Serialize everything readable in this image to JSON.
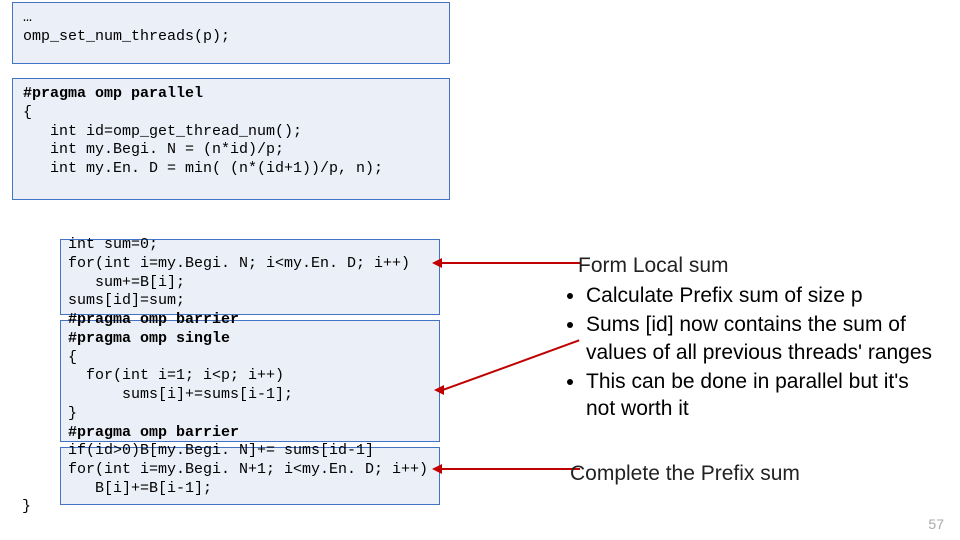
{
  "code": {
    "b1l1": "…",
    "b1l2": "omp_set_num_threads(p);",
    "b2l1a": "#pragma omp parallel",
    "b2l2": "{",
    "b2l3": "   int id=omp_get_thread_num();",
    "b2l4": "   int my.Begi. N = (n*id)/p;",
    "b2l5": "   int my.En. D = min( (n*(id+1))/p, n);",
    "b3l1": "int sum=0;",
    "b3l2": "for(int i=my.Begi. N; i<my.En. D; i++)",
    "b3l3": "   sum+=B[i];",
    "b3l4": "sums[id]=sum;",
    "b3l5a": "#pragma omp barrier",
    "b3l6a": "#pragma omp single",
    "b3l7": "{",
    "b3l8": "  for(int i=1; i<p; i++)",
    "b3l9": "      sums[i]+=sums[i-1];",
    "b3l10": "}",
    "b3l11a": "#pragma omp barrier",
    "b3l12": "if(id>0)B[my.Begi. N]+= sums[id-1]",
    "b3l13": "for(int i=my.Begi. N+1; i<my.En. D; i++)",
    "b3l14": "   B[i]+=B[i-1];",
    "brace": "}"
  },
  "notes": {
    "t1": "Form Local sum",
    "b1": "Calculate Prefix sum of size p",
    "b2": "Sums [id] now contains the sum of values of all previous threads' ranges",
    "b3": "This can be done in parallel but it's not worth it",
    "t2": "Complete the Prefix sum"
  },
  "page": "57"
}
